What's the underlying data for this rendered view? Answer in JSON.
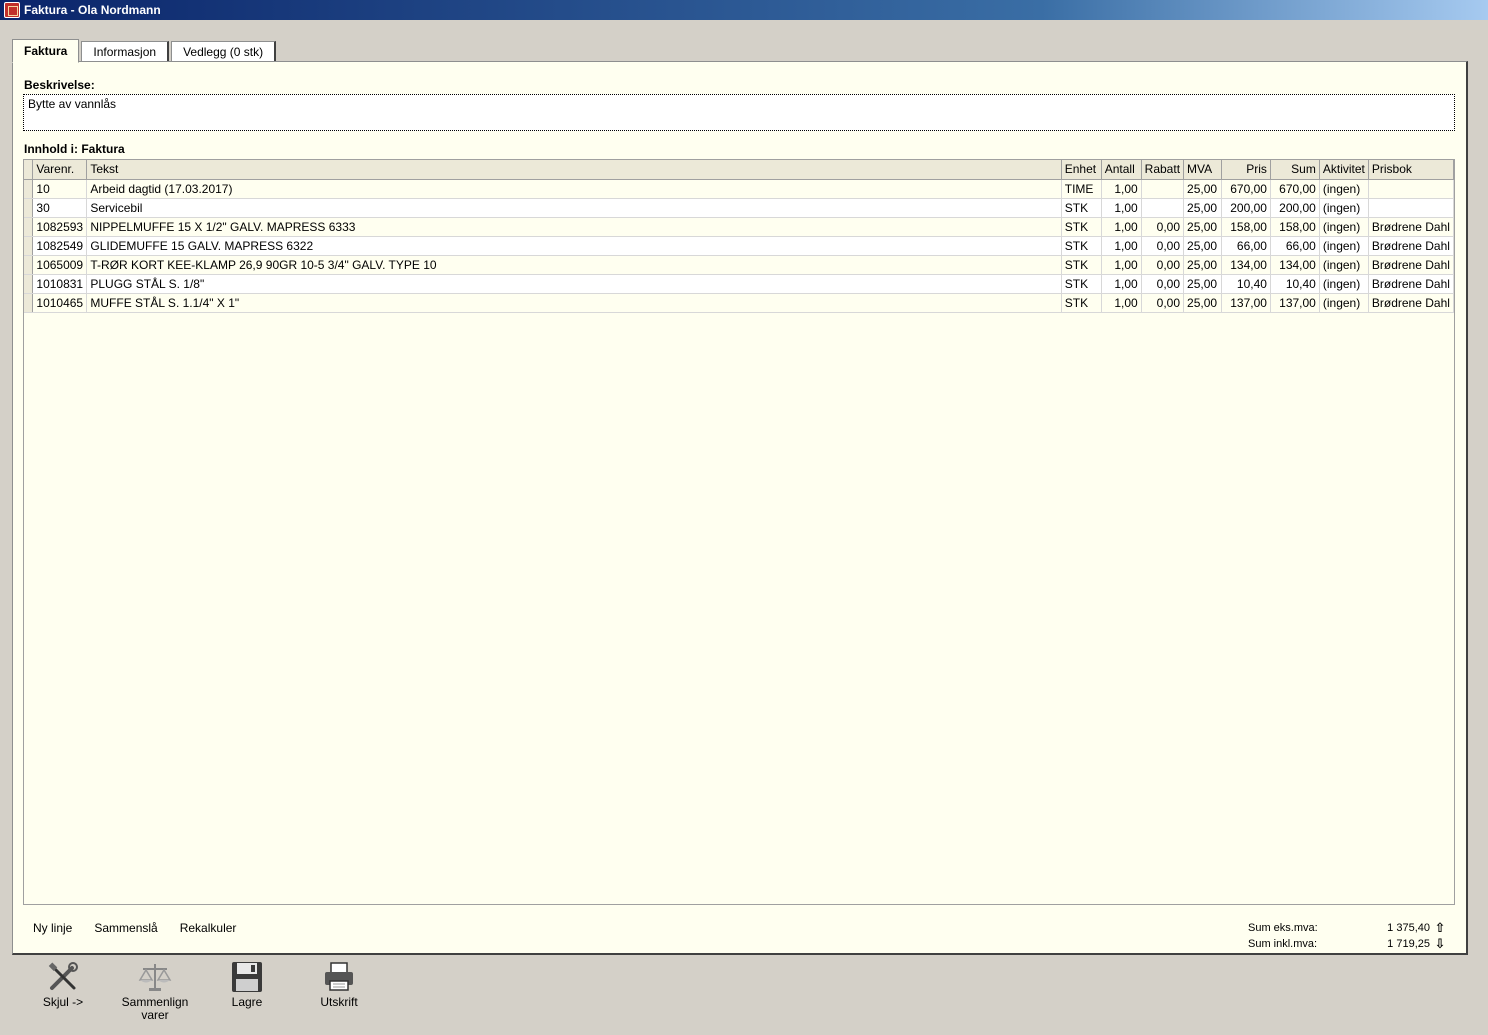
{
  "window": {
    "title": "Faktura - Ola Nordmann"
  },
  "tabs": [
    {
      "label": "Faktura",
      "active": true
    },
    {
      "label": "Informasjon",
      "active": false
    },
    {
      "label": "Vedlegg (0 stk)",
      "active": false
    }
  ],
  "description": {
    "label": "Beskrivelse:",
    "value": "Bytte av vannlås"
  },
  "content": {
    "label": "Innhold i: Faktura",
    "columns": [
      "Varenr.",
      "Tekst",
      "Enhet",
      "Antall",
      "Rabatt",
      "MVA",
      "Pris",
      "Sum",
      "Aktivitet",
      "Prisbok"
    ],
    "rows": [
      {
        "varenr": "10",
        "tekst": "Arbeid dagtid (17.03.2017)",
        "enhet": "TIME",
        "antall": "1,00",
        "rabatt": "",
        "mva": "25,00",
        "pris": "670,00",
        "sum": "670,00",
        "aktivitet": "(ingen)",
        "prisbok": ""
      },
      {
        "varenr": "30",
        "tekst": "Servicebil",
        "enhet": "STK",
        "antall": "1,00",
        "rabatt": "",
        "mva": "25,00",
        "pris": "200,00",
        "sum": "200,00",
        "aktivitet": "(ingen)",
        "prisbok": ""
      },
      {
        "varenr": "1082593",
        "tekst": "NIPPELMUFFE 15 X   1/2\" GALV. MAPRESS 6333",
        "enhet": "STK",
        "antall": "1,00",
        "rabatt": "0,00",
        "mva": "25,00",
        "pris": "158,00",
        "sum": "158,00",
        "aktivitet": "(ingen)",
        "prisbok": "Brødrene Dahl"
      },
      {
        "varenr": "1082549",
        "tekst": "GLIDEMUFFE  15  GALV. MAPRESS 6322",
        "enhet": "STK",
        "antall": "1,00",
        "rabatt": "0,00",
        "mva": "25,00",
        "pris": "66,00",
        "sum": "66,00",
        "aktivitet": "(ingen)",
        "prisbok": "Brødrene Dahl"
      },
      {
        "varenr": "1065009",
        "tekst": "T-RØR KORT KEE-KLAMP 26,9 90GR 10-5 3/4\" GALV. TYPE 10",
        "enhet": "STK",
        "antall": "1,00",
        "rabatt": "0,00",
        "mva": "25,00",
        "pris": "134,00",
        "sum": "134,00",
        "aktivitet": "(ingen)",
        "prisbok": "Brødrene Dahl"
      },
      {
        "varenr": "1010831",
        "tekst": "PLUGG STÅL S.     1/8\"",
        "enhet": "STK",
        "antall": "1,00",
        "rabatt": "0,00",
        "mva": "25,00",
        "pris": "10,40",
        "sum": "10,40",
        "aktivitet": "(ingen)",
        "prisbok": "Brødrene Dahl"
      },
      {
        "varenr": "1010465",
        "tekst": "MUFFE STÅL S. 1.1/4\" X 1\"",
        "enhet": "STK",
        "antall": "1,00",
        "rabatt": "0,00",
        "mva": "25,00",
        "pris": "137,00",
        "sum": "137,00",
        "aktivitet": "(ingen)",
        "prisbok": "Brødrene Dahl"
      }
    ]
  },
  "links": {
    "new_line": "Ny linje",
    "merge": "Sammenslå",
    "recalc": "Rekalkuler"
  },
  "totals": {
    "ex_vat_label": "Sum eks.mva:",
    "ex_vat_value": "1 375,40",
    "inc_vat_label": "Sum inkl.mva:",
    "inc_vat_value": "1 719,25"
  },
  "toolbar": {
    "hide": "Skjul ->",
    "compare_line1": "Sammenlign",
    "compare_line2": "varer",
    "save": "Lagre",
    "print": "Utskrift"
  },
  "icons": {
    "window": "app-icon",
    "hide": "tools-icon",
    "compare": "scale-icon",
    "save": "floppy-disk-icon",
    "print": "printer-icon",
    "up": "arrow-up-icon",
    "down": "arrow-down-icon"
  }
}
